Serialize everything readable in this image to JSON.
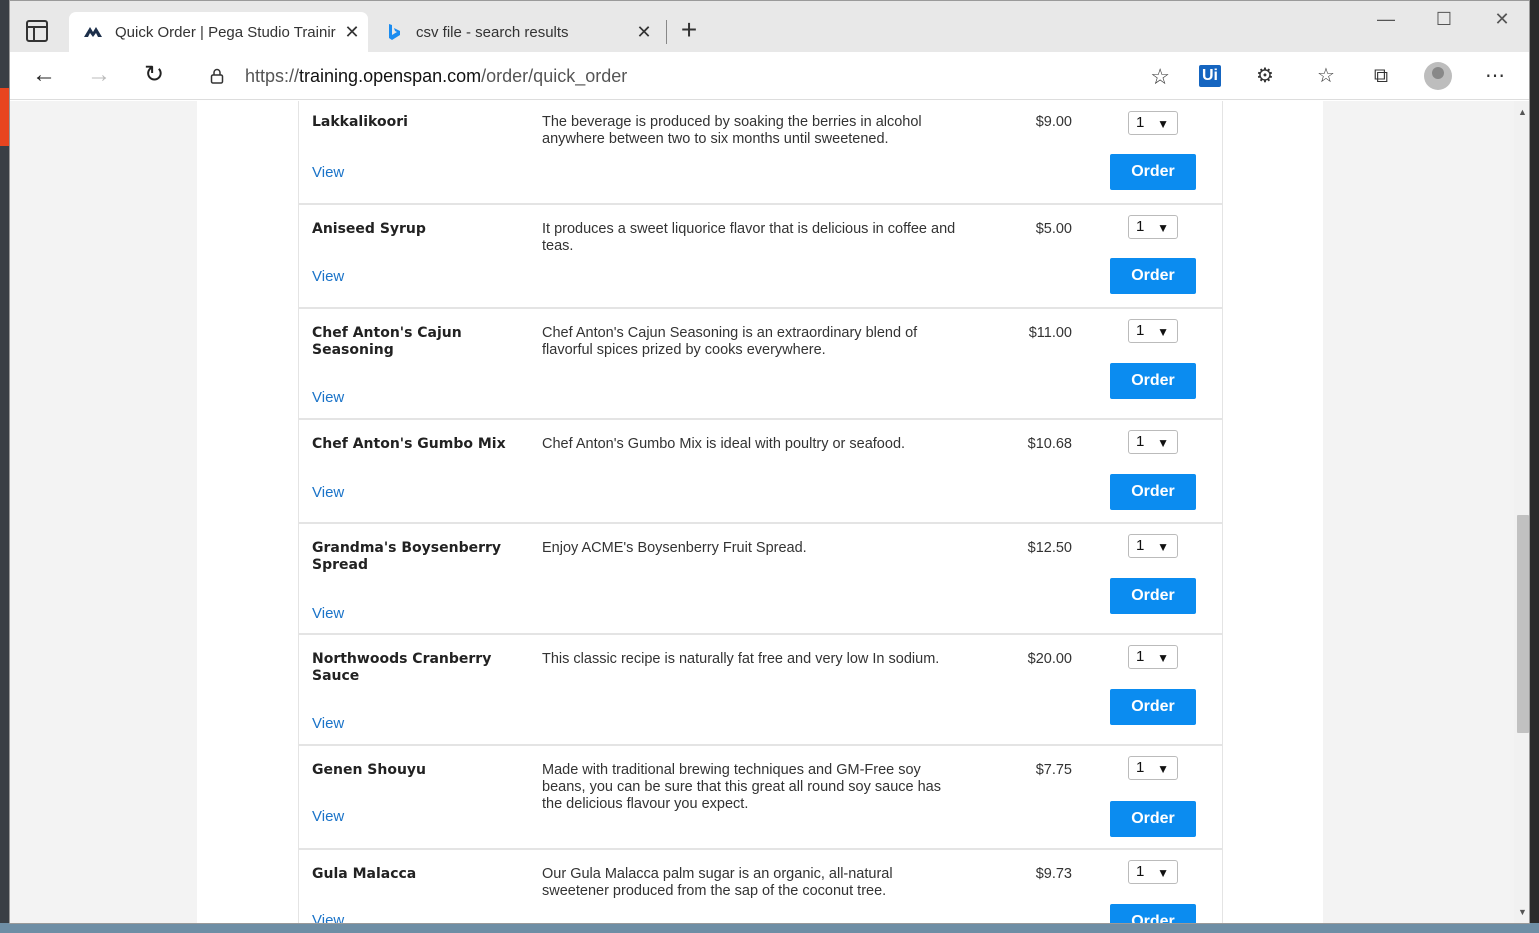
{
  "browser": {
    "tabs": [
      {
        "title": "Quick Order | Pega Studio Trainir",
        "active": true,
        "icon": "pega-icon"
      },
      {
        "title": "csv file - search results",
        "active": false,
        "icon": "bing-icon"
      }
    ],
    "url_scheme": "https://",
    "url_host": "training.openspan.com",
    "url_path": "/order/quick_order"
  },
  "labels": {
    "view": "View",
    "order": "Order"
  },
  "products": [
    {
      "name": "Lakkalikoori",
      "description": "The beverage is produced by soaking the berries in alcohol anywhere between two to six months until sweetened.",
      "price": "$9.00",
      "qty": "1"
    },
    {
      "name": "Aniseed Syrup",
      "description": "It produces a sweet liquorice flavor that is delicious in coffee and teas.",
      "price": "$5.00",
      "qty": "1"
    },
    {
      "name": "Chef Anton's Cajun Seasoning",
      "description": "Chef Anton's Cajun Seasoning is an extraordinary blend of flavorful spices prized by cooks everywhere.",
      "price": "$11.00",
      "qty": "1"
    },
    {
      "name": "Chef Anton's Gumbo Mix",
      "description": "Chef Anton's Gumbo Mix is ideal with poultry or seafood.",
      "price": "$10.68",
      "qty": "1"
    },
    {
      "name": "Grandma's Boysenberry Spread",
      "description": "Enjoy ACME's Boysenberry Fruit Spread.",
      "price": "$12.50",
      "qty": "1"
    },
    {
      "name": "Northwoods Cranberry Sauce",
      "description": "This classic recipe is naturally fat free and very low In sodium.",
      "price": "$20.00",
      "qty": "1"
    },
    {
      "name": "Genen Shouyu",
      "description": "Made with traditional brewing techniques and GM-Free soy beans, you can be sure that this great all round soy sauce has the delicious flavour you expect.",
      "price": "$7.75",
      "qty": "1"
    },
    {
      "name": "Gula Malacca",
      "description": "Our Gula Malacca palm sugar is an organic, all-natural sweetener produced from the sap of the coconut tree.",
      "price": "$9.73",
      "qty": "1"
    }
  ],
  "colors": {
    "order_button": "#0b8cf0",
    "link": "#1a73c8"
  }
}
